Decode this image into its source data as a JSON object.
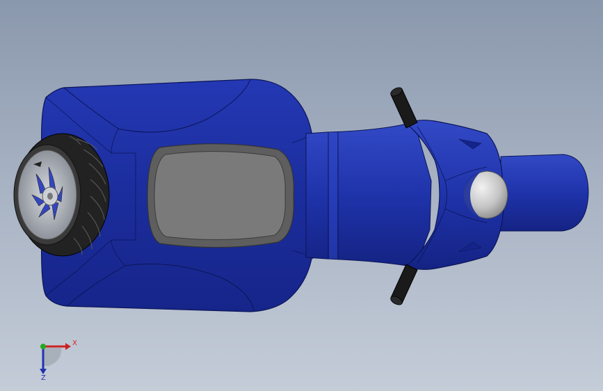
{
  "scene": {
    "model": "scooter",
    "view": "top",
    "colors": {
      "background_top": "#8a98ad",
      "background_bottom": "#c4ccd8",
      "body_blue": "#1d2f9e",
      "body_blue_light": "#2e46c8",
      "body_blue_dark": "#101c6e",
      "seat_gray": "#7a7a7a",
      "seat_rim": "#5a5a5a",
      "tire_black": "#222222",
      "rim_silver": "#b8bcc2",
      "grip_black": "#1a1a1a",
      "headlight_silver": "#c9c9c9"
    }
  },
  "triad": {
    "x_label": "X",
    "z_label": "Z",
    "colors": {
      "x": "#cc2222",
      "y": "#22aa22",
      "z": "#2233aa"
    }
  }
}
